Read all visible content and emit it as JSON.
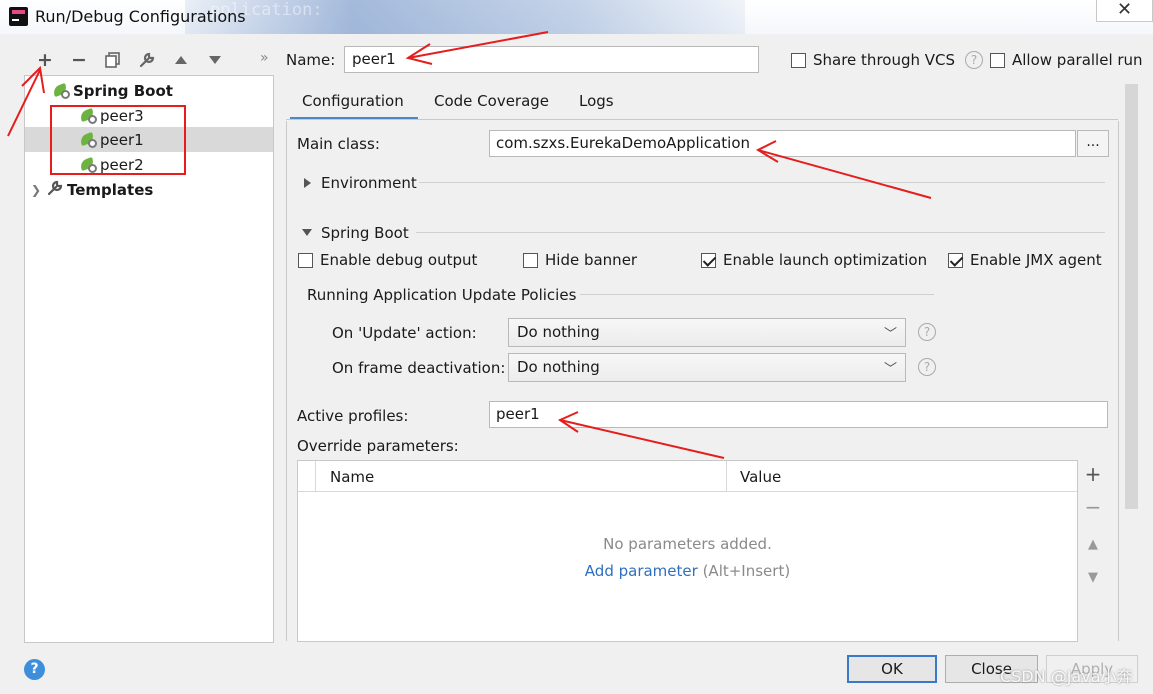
{
  "window": {
    "title": "Run/Debug Configurations",
    "ghost_text": "pplication:",
    "close_symbol": "✕"
  },
  "toolbar": {
    "buttons": [
      "+",
      "−",
      "❐",
      "🔧",
      "▲",
      "▼"
    ],
    "more": "»"
  },
  "tree": {
    "spring_boot_label": "Spring Boot",
    "items": [
      "peer3",
      "peer1",
      "peer2"
    ],
    "selected": "peer1",
    "templates_label": "Templates"
  },
  "header": {
    "name_label": "Name:",
    "name_value": "peer1",
    "share_vcs_label": "Share through VCS",
    "allow_parallel_label": "Allow parallel run"
  },
  "tabs": [
    "Configuration",
    "Code Coverage",
    "Logs"
  ],
  "config": {
    "main_class_label": "Main class:",
    "main_class_value": "com.szxs.EurekaDemoApplication",
    "browse_label": "...",
    "environment_label": "Environment",
    "spring_boot_section": "Spring Boot",
    "checkboxes": [
      {
        "label": "Enable debug output",
        "checked": false
      },
      {
        "label": "Hide banner",
        "checked": false
      },
      {
        "label": "Enable launch optimization",
        "checked": true
      },
      {
        "label": "Enable JMX agent",
        "checked": true
      }
    ],
    "policies_label": "Running Application Update Policies",
    "on_update_label": "On 'Update' action:",
    "on_update_value": "Do nothing",
    "on_frame_label": "On frame deactivation:",
    "on_frame_value": "Do nothing",
    "active_profiles_label": "Active profiles:",
    "active_profiles_value": "peer1",
    "override_label": "Override parameters:",
    "params": {
      "col_name": "Name",
      "col_value": "Value",
      "empty_text": "No parameters added.",
      "add_link": "Add parameter",
      "add_shortcut": "(Alt+Insert)"
    }
  },
  "buttons": {
    "ok": "OK",
    "close": "Close",
    "apply": "Apply"
  },
  "watermark": "CSDN @Java小奔",
  "colors": {
    "annotation_red": "#e51d1d",
    "tab_accent": "#4a88c7",
    "link_blue": "#2f6fbf",
    "spring_green": "#6db33f"
  }
}
